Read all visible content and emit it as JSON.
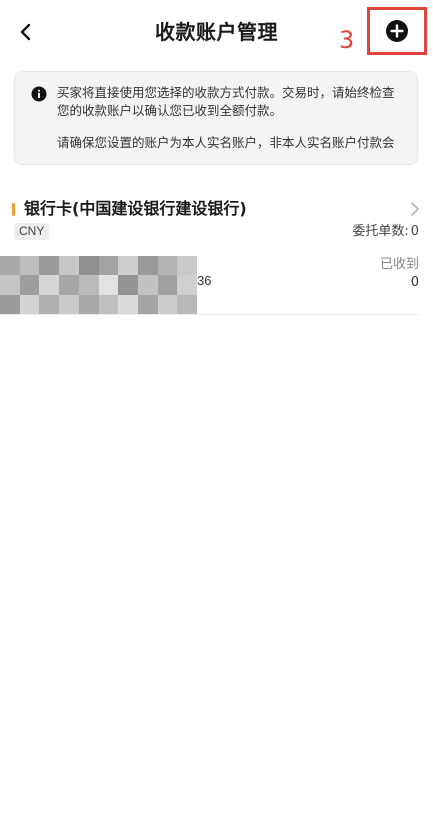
{
  "header": {
    "title": "收款账户管理",
    "step_marker": "3",
    "back_icon": "chevron-left-icon",
    "add_icon": "plus-circle-icon",
    "highlight_color": "#e0443a"
  },
  "notice": {
    "icon": "info-icon",
    "line1": "买家将直接使用您选择的收款方式付款。交易时，请始终检查",
    "line2": "您的收款账户以确认您已收到全额付款。",
    "line3": "请确保您设置的账户为本人实名账户，非本人实名账户付款会"
  },
  "account": {
    "accent_color": "#f0a03c",
    "name": "银行卡(中国建设银行建设银行)",
    "currency": "CNY",
    "delegate_label": "委托单数:",
    "delegate_count": "0",
    "number_tail": "36",
    "received_label": "已收到",
    "received_value": "0"
  }
}
